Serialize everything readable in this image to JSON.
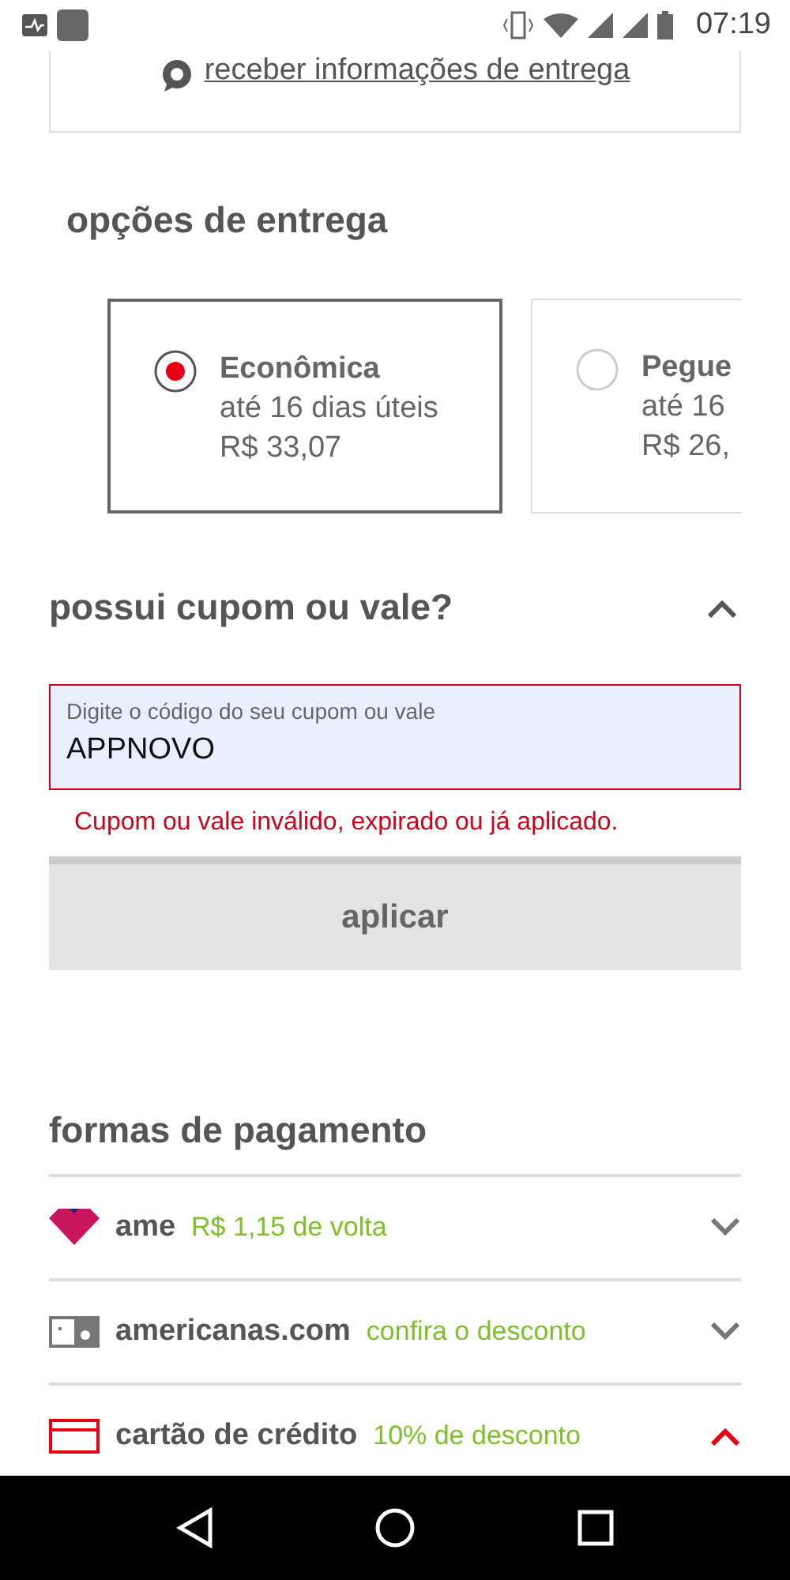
{
  "status_bar": {
    "time": "07:19"
  },
  "delivery_info": {
    "link": "receber informações de entrega"
  },
  "delivery_options": {
    "title": "opções de entrega",
    "options": [
      {
        "name": "Econômica",
        "term": "até 16 dias úteis",
        "price": "R$ 33,07",
        "selected": true
      },
      {
        "name": "Pegue",
        "term": "até 16",
        "price": "R$ 26,",
        "selected": false
      }
    ]
  },
  "coupon": {
    "title": "possui cupom ou vale?",
    "expanded": true,
    "label": "Digite o código do seu cupom ou vale",
    "value": "APPNOVO",
    "error": "Cupom ou vale inválido, expirado ou já aplicado.",
    "button": "aplicar"
  },
  "payment": {
    "title": "formas de pagamento",
    "methods": [
      {
        "kind": "heart",
        "name": "ame",
        "offer": "R$ 1,15 de volta",
        "expanded": false
      },
      {
        "kind": "voucher",
        "name": "americanas.com",
        "offer": "confira o desconto",
        "expanded": false
      },
      {
        "kind": "card",
        "name": "cartão de crédito",
        "offer": "10% de desconto",
        "expanded": true
      }
    ]
  }
}
